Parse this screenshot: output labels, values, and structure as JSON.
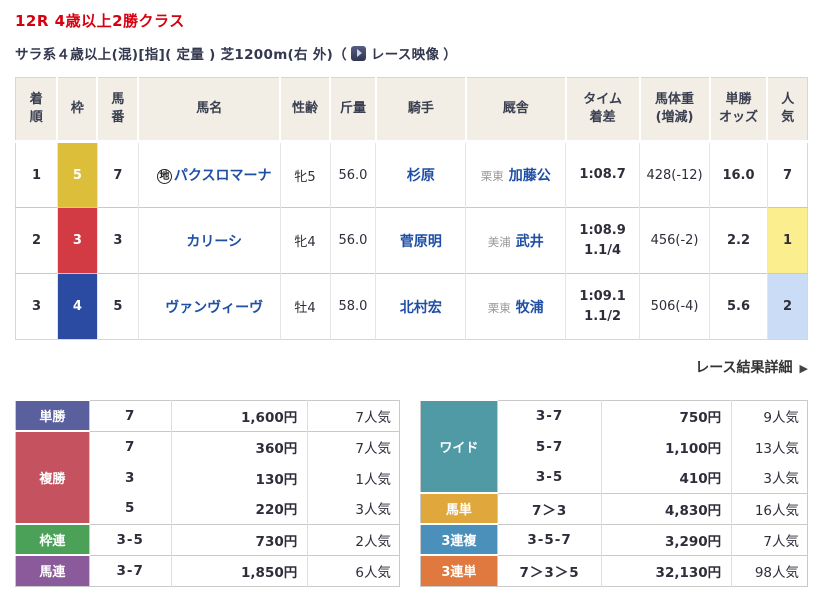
{
  "page": {
    "title": "12R 4歳以上2勝クラス",
    "conditions": "サラ系４歳以上(混)[指]( 定量 ) 芝1200m(右 外)",
    "paren_open": "（",
    "video_label": "レース映像",
    "paren_close": "）",
    "detail_link": "レース結果詳細",
    "detail_arrow": "▶"
  },
  "colors": {
    "title_red": "#d7000f",
    "link_blue": "#1f4fa5",
    "header_beige": "#f2eee6"
  },
  "results": {
    "headers": {
      "rank": "着\n順",
      "waku": "枠",
      "umaban": "馬\n番",
      "name": "馬名",
      "sexage": "性齢",
      "weight": "斤量",
      "jockey": "騎手",
      "stable": "厩舎",
      "time": "タイム\n着差",
      "hweight": "馬体重\n(増減)",
      "odds": "単勝\nオッズ",
      "pop": "人\n気"
    },
    "rows": [
      {
        "rank": "1",
        "waku": "5",
        "waku_color": "#ddbe3b",
        "umaban": "7",
        "mark": "地",
        "name": "パクスロマーナ",
        "sexage": "牝5",
        "weight": "56.0",
        "jockey": "杉原",
        "region": "栗東",
        "trainer": "加藤公",
        "time": "1:08.7",
        "margin": "",
        "horse_weight": "428(-12)",
        "odds": "16.0",
        "pop": "7",
        "pop_color": ""
      },
      {
        "rank": "2",
        "waku": "3",
        "waku_color": "#d23b44",
        "umaban": "3",
        "mark": "",
        "name": "カリーシ",
        "sexage": "牝4",
        "weight": "56.0",
        "jockey": "菅原明",
        "region": "美浦",
        "trainer": "武井",
        "time": "1:08.9",
        "margin": "1.1/4",
        "horse_weight": "456(-2)",
        "odds": "2.2",
        "pop": "1",
        "pop_color": "#fbee8e"
      },
      {
        "rank": "3",
        "waku": "4",
        "waku_color": "#2b4aa2",
        "umaban": "5",
        "mark": "",
        "name": "ヴァンヴィーヴ",
        "sexage": "牡4",
        "weight": "58.0",
        "jockey": "北村宏",
        "region": "栗東",
        "trainer": "牧浦",
        "time": "1:09.1",
        "margin": "1.1/2",
        "horse_weight": "506(-4)",
        "odds": "5.6",
        "pop": "2",
        "pop_color": "#cadcf6"
      }
    ]
  },
  "payouts": {
    "left": {
      "groups": [
        {
          "label": "単勝",
          "color": "#5a5f9e",
          "rows": [
            {
              "combo": "7",
              "amount": "1,600円",
              "pop": "7人気"
            }
          ]
        },
        {
          "label": "複勝",
          "color": "#c5525f",
          "rows": [
            {
              "combo": "7",
              "amount": "360円",
              "pop": "7人気"
            },
            {
              "combo": "3",
              "amount": "130円",
              "pop": "1人気"
            },
            {
              "combo": "5",
              "amount": "220円",
              "pop": "3人気"
            }
          ]
        },
        {
          "label": "枠連",
          "color": "#4aa157",
          "rows": [
            {
              "combo": "3-5",
              "amount": "730円",
              "pop": "2人気"
            }
          ]
        },
        {
          "label": "馬連",
          "color": "#8a5a9b",
          "rows": [
            {
              "combo": "3-7",
              "amount": "1,850円",
              "pop": "6人気"
            }
          ]
        }
      ]
    },
    "right": {
      "groups": [
        {
          "label": "ワイド",
          "color": "#4f9aa5",
          "rows": [
            {
              "combo": "3-7",
              "amount": "750円",
              "pop": "9人気"
            },
            {
              "combo": "5-7",
              "amount": "1,100円",
              "pop": "13人気"
            },
            {
              "combo": "3-5",
              "amount": "410円",
              "pop": "3人気"
            }
          ]
        },
        {
          "label": "馬単",
          "color": "#e0a83c",
          "rows": [
            {
              "combo": "7＞3",
              "amount": "4,830円",
              "pop": "16人気"
            }
          ]
        },
        {
          "label": "3連複",
          "color": "#4a90bb",
          "rows": [
            {
              "combo": "3-5-7",
              "amount": "3,290円",
              "pop": "7人気"
            }
          ]
        },
        {
          "label": "3連単",
          "color": "#e0793f",
          "rows": [
            {
              "combo": "7＞3＞5",
              "amount": "32,130円",
              "pop": "98人気"
            }
          ]
        }
      ]
    }
  }
}
